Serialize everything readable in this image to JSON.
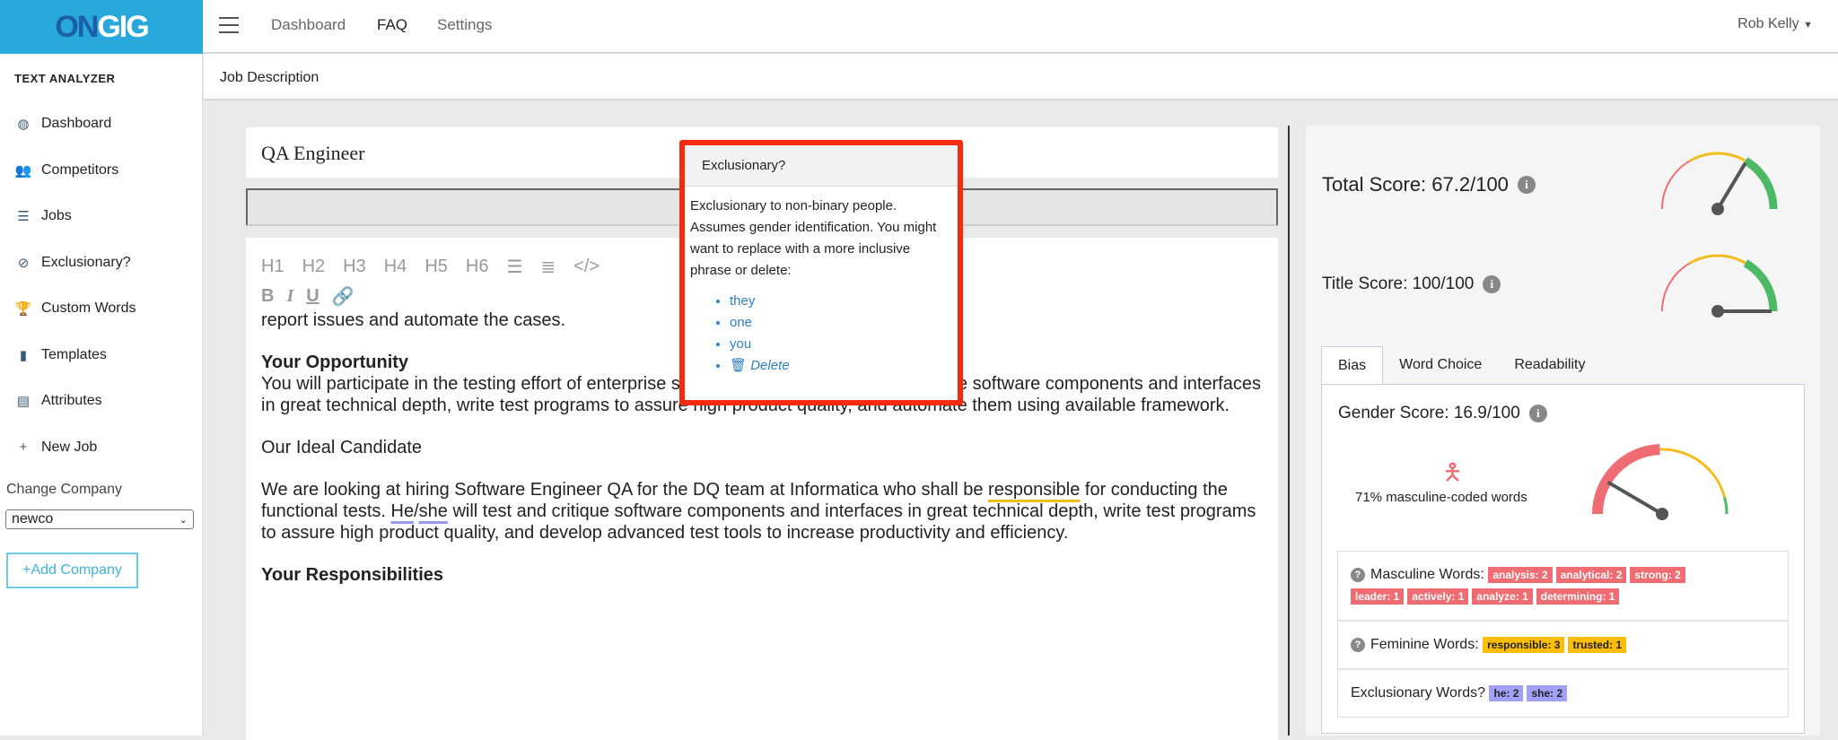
{
  "brand": {
    "logo_on": "ON",
    "logo_gig": "GIG",
    "color": "#29a8dc"
  },
  "topnav": {
    "items": [
      "Dashboard",
      "FAQ",
      "Settings"
    ],
    "active": "FAQ",
    "user": "Rob Kelly"
  },
  "sidebar": {
    "title": "TEXT ANALYZER",
    "items": [
      {
        "label": "Dashboard",
        "icon": "tachometer-icon",
        "glyph": "◍"
      },
      {
        "label": "Competitors",
        "icon": "users-icon",
        "glyph": "👥"
      },
      {
        "label": "Jobs",
        "icon": "list-icon",
        "glyph": "☰"
      },
      {
        "label": "Exclusionary?",
        "icon": "ban-icon",
        "glyph": "⊘"
      },
      {
        "label": "Custom Words",
        "icon": "trophy-icon",
        "glyph": "🏆"
      },
      {
        "label": "Templates",
        "icon": "file-icon",
        "glyph": "▮"
      },
      {
        "label": "Attributes",
        "icon": "server-icon",
        "glyph": "▤"
      },
      {
        "label": "New Job",
        "icon": "plus-icon",
        "glyph": "+"
      }
    ],
    "change_company_label": "Change Company",
    "company_value": "newco",
    "add_company": "+Add Company"
  },
  "subheader": {
    "title": "Job Description"
  },
  "editor": {
    "job_title": "QA Engineer",
    "toolbar": [
      "H1",
      "H2",
      "H3",
      "H4",
      "H5",
      "H6"
    ],
    "content": {
      "line1": "report issues and automate the cases.",
      "h_opportunity": "Your Opportunity",
      "p1_a": "You will participate in the testing effort of enterprise  software. ",
      "he": "He",
      "slash": "/",
      "she": "she",
      "p1_b": " will test and critique software components and interfaces in great technical depth, write test programs to assure high product quality, and automate them using available framework.",
      "ideal": "Our Ideal Candidate",
      "p2_a": "We are looking at hiring Software Engineer QA for the DQ team at Informatica who shall be ",
      "responsible": "responsible",
      "p2_b": " for conducting the functional tests. ",
      "p2_c": " will test and critique software components and interfaces in great technical depth, write test programs to assure high product quality, and develop advanced test tools to increase productivity and efficiency.",
      "h_resp": "Your Responsibilities"
    }
  },
  "popup": {
    "title": "Exclusionary?",
    "body": "Exclusionary to non-binary people. Assumes gender identification. You might want to replace with a more inclusive phrase or delete:",
    "options": [
      "they",
      "one",
      "you"
    ],
    "delete": "Delete",
    "border_color": "#f52a0f"
  },
  "scores": {
    "total": {
      "label": "Total Score: 67.2/100",
      "value": 67.2
    },
    "title": {
      "label": "Title Score: 100/100",
      "value": 100
    }
  },
  "tabs": [
    "Bias",
    "Word Choice",
    "Readability"
  ],
  "bias": {
    "gender_label": "Gender Score: 16.9/100",
    "gender_value": 16.9,
    "masc_pct": "71% masculine-coded words",
    "masculine_label": "Masculine Words:",
    "masculine": [
      "analysis: 2",
      "analytical: 2",
      "strong: 2",
      "leader: 1",
      "actively: 1",
      "analyze: 1",
      "determining: 1"
    ],
    "feminine_label": "Feminine Words:",
    "feminine": [
      "responsible: 3",
      "trusted: 1"
    ],
    "exclusionary_label": "Exclusionary Words?",
    "exclusionary": [
      "he: 2",
      "she: 2"
    ]
  },
  "colors": {
    "red": "#ef6c72",
    "yellow": "#f2bd1c",
    "green": "#4cb964",
    "needle": "#555"
  }
}
